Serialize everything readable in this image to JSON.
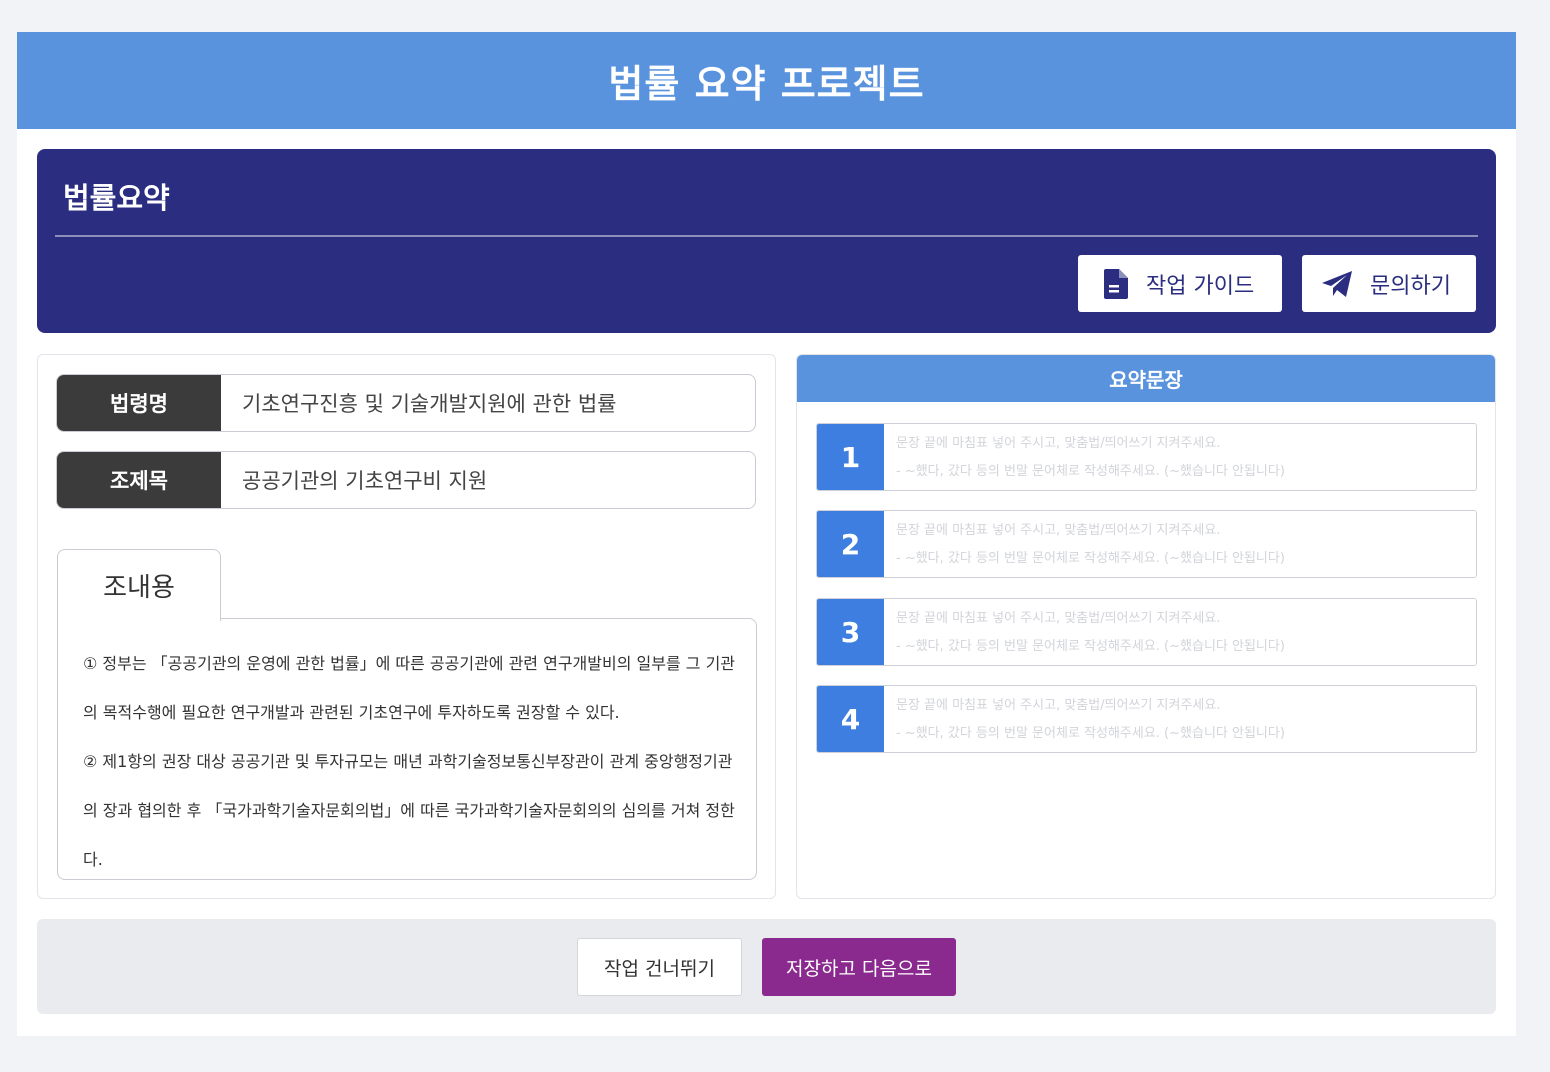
{
  "app": {
    "title": "법률 요약 프로젝트"
  },
  "header": {
    "title": "법률요약",
    "guide_label": "작업 가이드",
    "inquiry_label": "문의하기"
  },
  "law": {
    "name_label": "법령명",
    "name_value": "기초연구진흥 및 기술개발지원에 관한 법률",
    "article_label": "조제목",
    "article_value": "공공기관의 기초연구비 지원",
    "content_label": "조내용",
    "content_paragraphs": [
      "① 정부는 「공공기관의 운영에 관한 법률」에 따른 공공기관에 관련 연구개발비의 일부를 그 기관의 목적수행에 필요한 연구개발과 관련된 기초연구에 투자하도록 권장할 수 있다.",
      "② 제1항의 권장 대상 공공기관 및 투자규모는 매년 과학기술정보통신부장관이 관계 중앙행정기관의 장과 협의한 후 「국가과학기술자문회의법」에 따른 국가과학기술자문회의의 심의를 거쳐 정한다."
    ]
  },
  "summary": {
    "title": "요약문장",
    "placeholder": "문장 끝에 마침표 넣어 주시고, 맞춤법/띄어쓰기 지켜주세요.\n- ~했다, 갔다 등의 번말 문어체로 작성해주세요. (~했습니다 안됩니다)",
    "items": [
      {
        "num": "1",
        "value": ""
      },
      {
        "num": "2",
        "value": ""
      },
      {
        "num": "3",
        "value": ""
      },
      {
        "num": "4",
        "value": ""
      }
    ]
  },
  "footer": {
    "skip_label": "작업 건너뛰기",
    "save_label": "저장하고 다음으로"
  },
  "colors": {
    "topbar": "#5a93dd",
    "header": "#2b2e80",
    "label_bg": "#3b3b3b",
    "number_bg": "#3d7ee0",
    "save_button": "#8a2a8f"
  }
}
